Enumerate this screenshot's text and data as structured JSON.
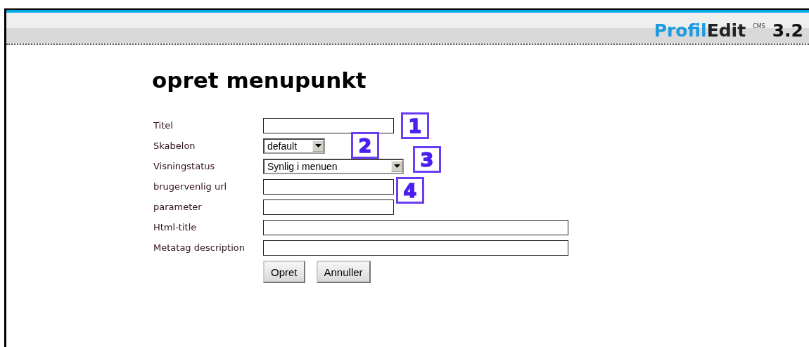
{
  "header": {
    "logo": {
      "part1": "Profil",
      "part2": "Edit",
      "superscript": "CMS",
      "version": "3.2"
    }
  },
  "page": {
    "title": "opret menupunkt",
    "fields": [
      {
        "label": "Titel",
        "kind": "text"
      },
      {
        "label": "Skabelon",
        "kind": "select",
        "value": "default"
      },
      {
        "label": "Visningstatus",
        "kind": "select",
        "value": "Synlig i menuen"
      },
      {
        "label": "brugervenlig url",
        "kind": "text"
      },
      {
        "label": "parameter",
        "kind": "text"
      },
      {
        "label": "Html-title",
        "kind": "text"
      },
      {
        "label": "Metatag description",
        "kind": "text"
      }
    ],
    "buttons": [
      "Opret",
      "Annuller"
    ],
    "callouts": [
      "1",
      "2",
      "3",
      "4"
    ]
  }
}
